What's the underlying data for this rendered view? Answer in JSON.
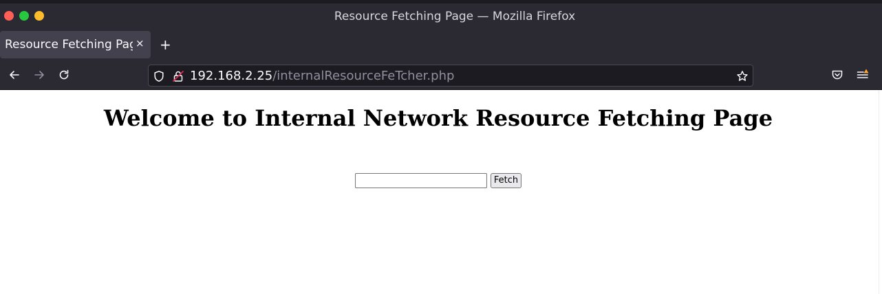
{
  "window": {
    "title": "Resource Fetching Page — Mozilla Firefox"
  },
  "tabs": [
    {
      "label": "Resource Fetching Page",
      "close_glyph": "×",
      "active": true
    }
  ],
  "new_tab_glyph": "+",
  "toolbar": {
    "back_icon": "arrow-left-icon",
    "forward_icon": "arrow-right-icon",
    "reload_icon": "reload-icon",
    "pocket_icon": "pocket-icon",
    "menu_icon": "hamburger-menu-icon"
  },
  "urlbar": {
    "host": "192.168.2.25",
    "path": "/internalResourceFeTcher.php",
    "tracking_icon": "shield-icon",
    "security_icon": "broken-lock-icon",
    "bookmark_icon": "star-icon"
  },
  "page": {
    "heading": "Welcome to Internal Network Resource Fetching Page",
    "input_value": "",
    "button_label": "Fetch"
  },
  "colors": {
    "chrome_bg": "#2b2a33",
    "tab_bg": "#42414d",
    "urlbar_bg": "#1c1b22",
    "close_dot": "#ff5f57",
    "minimize_dot": "#ffbd2e",
    "maximize_dot": "#28c940",
    "menu_badge": "#ffa436"
  }
}
